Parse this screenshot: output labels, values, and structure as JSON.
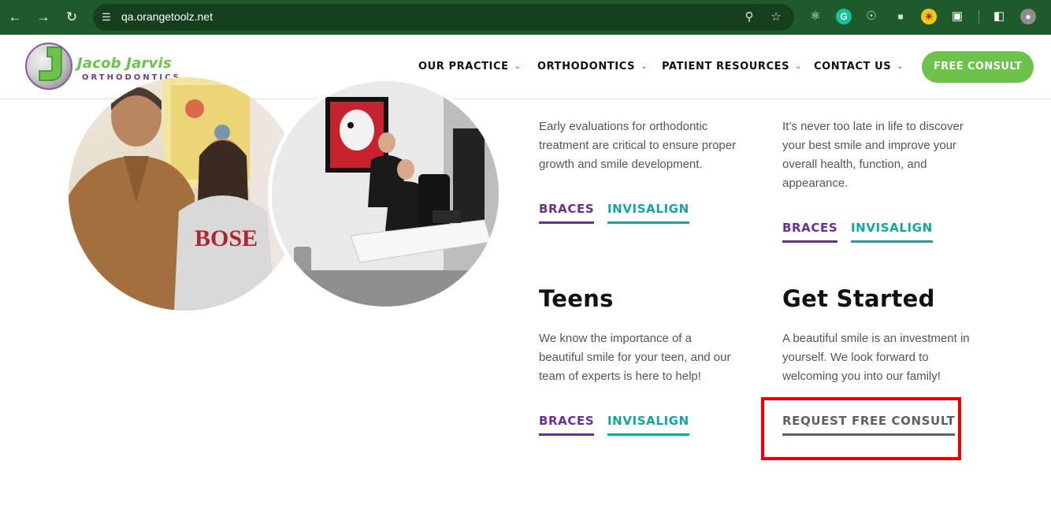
{
  "browser": {
    "url": "qa.orangetoolz.net",
    "back_icon": "arrow-left",
    "forward_icon": "arrow-right",
    "reload_icon": "reload",
    "extensions": [
      "react-devtools",
      "grammarly",
      "globe",
      "camera",
      "sun-ext",
      "puzzle",
      "side-panel",
      "profile"
    ]
  },
  "site": {
    "logo": {
      "name": "Jacob Jarvis",
      "sub": "ORTHODONTICS"
    },
    "menu": [
      {
        "label": "OUR PRACTICE"
      },
      {
        "label": "ORTHODONTICS"
      },
      {
        "label": "PATIENT RESOURCES"
      },
      {
        "label": "CONTACT US"
      }
    ],
    "cta": "FREE CONSULT"
  },
  "sections": {
    "children": {
      "desc": [
        "Early evaluations for orthodontic",
        "treatment are critical to ensure proper",
        "growth and smile development."
      ],
      "braces": "BRACES",
      "invisalign": "INVISALIGN"
    },
    "adults": {
      "desc": [
        "It’s never too late in life to discover",
        "your best smile and improve your",
        "overall health, function, and",
        "appearance."
      ],
      "braces": "BRACES",
      "invisalign": "INVISALIGN"
    },
    "teens": {
      "title": "Teens",
      "desc": [
        "We know the importance of a",
        "beautiful smile for your teen, and our",
        "team of experts is here to help!"
      ],
      "braces": "BRACES",
      "invisalign": "INVISALIGN"
    },
    "get_started": {
      "title": "Get Started",
      "desc": [
        "A beautiful smile is an investment in",
        "yourself. We look forward to",
        "welcoming you into our family!"
      ],
      "consult": "REQUEST FREE CONSULT"
    }
  },
  "colors": {
    "chrome": "#1f5b2a",
    "brand_green": "#6cc24a",
    "brand_purple": "#6b2f8f",
    "brand_teal": "#16a4a0",
    "highlight": "#ee0000"
  }
}
